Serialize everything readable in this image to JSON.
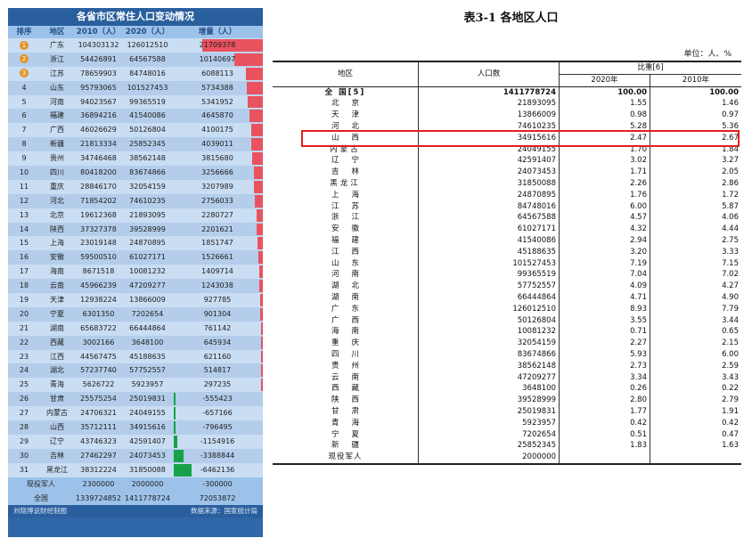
{
  "left": {
    "title": "各省市区常住人口变动情况",
    "headers": [
      "排序",
      "地区",
      "2010（人）",
      "2020（人）",
      "增量（人）"
    ],
    "max_abs": 21709378,
    "rows": [
      {
        "rank": "1",
        "region": "广东",
        "y2010": "104303132",
        "y2020": "126012510",
        "diff": "21709378",
        "v": 21709378
      },
      {
        "rank": "2",
        "region": "浙江",
        "y2010": "54426891",
        "y2020": "64567588",
        "diff": "10140697",
        "v": 10140697
      },
      {
        "rank": "3",
        "region": "江苏",
        "y2010": "78659903",
        "y2020": "84748016",
        "diff": "6088113",
        "v": 6088113
      },
      {
        "rank": "4",
        "region": "山东",
        "y2010": "95793065",
        "y2020": "101527453",
        "diff": "5734388",
        "v": 5734388
      },
      {
        "rank": "5",
        "region": "河南",
        "y2010": "94023567",
        "y2020": "99365519",
        "diff": "5341952",
        "v": 5341952
      },
      {
        "rank": "6",
        "region": "福建",
        "y2010": "36894216",
        "y2020": "41540086",
        "diff": "4645870",
        "v": 4645870
      },
      {
        "rank": "7",
        "region": "广西",
        "y2010": "46026629",
        "y2020": "50126804",
        "diff": "4100175",
        "v": 4100175
      },
      {
        "rank": "8",
        "region": "新疆",
        "y2010": "21813334",
        "y2020": "25852345",
        "diff": "4039011",
        "v": 4039011
      },
      {
        "rank": "9",
        "region": "贵州",
        "y2010": "34746468",
        "y2020": "38562148",
        "diff": "3815680",
        "v": 3815680
      },
      {
        "rank": "10",
        "region": "四川",
        "y2010": "80418200",
        "y2020": "83674866",
        "diff": "3256666",
        "v": 3256666
      },
      {
        "rank": "11",
        "region": "重庆",
        "y2010": "28846170",
        "y2020": "32054159",
        "diff": "3207989",
        "v": 3207989
      },
      {
        "rank": "12",
        "region": "河北",
        "y2010": "71854202",
        "y2020": "74610235",
        "diff": "2756033",
        "v": 2756033
      },
      {
        "rank": "13",
        "region": "北京",
        "y2010": "19612368",
        "y2020": "21893095",
        "diff": "2280727",
        "v": 2280727
      },
      {
        "rank": "14",
        "region": "陕西",
        "y2010": "37327378",
        "y2020": "39528999",
        "diff": "2201621",
        "v": 2201621
      },
      {
        "rank": "15",
        "region": "上海",
        "y2010": "23019148",
        "y2020": "24870895",
        "diff": "1851747",
        "v": 1851747
      },
      {
        "rank": "16",
        "region": "安徽",
        "y2010": "59500510",
        "y2020": "61027171",
        "diff": "1526661",
        "v": 1526661
      },
      {
        "rank": "17",
        "region": "海南",
        "y2010": "8671518",
        "y2020": "10081232",
        "diff": "1409714",
        "v": 1409714
      },
      {
        "rank": "18",
        "region": "云南",
        "y2010": "45966239",
        "y2020": "47209277",
        "diff": "1243038",
        "v": 1243038
      },
      {
        "rank": "19",
        "region": "天津",
        "y2010": "12938224",
        "y2020": "13866009",
        "diff": "927785",
        "v": 927785
      },
      {
        "rank": "20",
        "region": "宁夏",
        "y2010": "6301350",
        "y2020": "7202654",
        "diff": "901304",
        "v": 901304
      },
      {
        "rank": "21",
        "region": "湖南",
        "y2010": "65683722",
        "y2020": "66444864",
        "diff": "761142",
        "v": 761142
      },
      {
        "rank": "22",
        "region": "西藏",
        "y2010": "3002166",
        "y2020": "3648100",
        "diff": "645934",
        "v": 645934
      },
      {
        "rank": "23",
        "region": "江西",
        "y2010": "44567475",
        "y2020": "45188635",
        "diff": "621160",
        "v": 621160
      },
      {
        "rank": "24",
        "region": "湖北",
        "y2010": "57237740",
        "y2020": "57752557",
        "diff": "514817",
        "v": 514817
      },
      {
        "rank": "25",
        "region": "青海",
        "y2010": "5626722",
        "y2020": "5923957",
        "diff": "297235",
        "v": 297235
      },
      {
        "rank": "26",
        "region": "甘肃",
        "y2010": "25575254",
        "y2020": "25019831",
        "diff": "-555423",
        "v": -555423
      },
      {
        "rank": "27",
        "region": "内蒙古",
        "y2010": "24706321",
        "y2020": "24049155",
        "diff": "-657166",
        "v": -657166
      },
      {
        "rank": "28",
        "region": "山西",
        "y2010": "35712111",
        "y2020": "34915616",
        "diff": "-796495",
        "v": -796495
      },
      {
        "rank": "29",
        "region": "辽宁",
        "y2010": "43746323",
        "y2020": "42591407",
        "diff": "-1154916",
        "v": -1154916
      },
      {
        "rank": "30",
        "region": "吉林",
        "y2010": "27462297",
        "y2020": "24073453",
        "diff": "-3388844",
        "v": -3388844
      },
      {
        "rank": "31",
        "region": "黑龙江",
        "y2010": "38312224",
        "y2020": "31850088",
        "diff": "-6462136",
        "v": -6462136
      }
    ],
    "military": {
      "label": "现役军人",
      "y2010": "2300000",
      "y2020": "2000000",
      "diff": "-300000"
    },
    "national": {
      "label": "全国",
      "y2010": "1339724852",
      "y2020": "1411778724",
      "diff": "72053872"
    },
    "footer_left": "刘晓博说财经制图",
    "footer_right": "数据来源：国家统计局"
  },
  "right": {
    "title": "表3-1 各地区人口",
    "unit": "单位：人、%",
    "col_region": "地区",
    "col_pop": "人口数",
    "col_share": "比重[6]",
    "col_2020": "2020年",
    "col_2010": "2010年",
    "total": {
      "name": "全 国[5]",
      "pop": "1411778724",
      "s2020": "100.00",
      "s2010": "100.00"
    },
    "rows": [
      {
        "name": "北京",
        "pop": "21893095",
        "s2020": "1.55",
        "s2010": "1.46"
      },
      {
        "name": "天津",
        "pop": "13866009",
        "s2020": "0.98",
        "s2010": "0.97"
      },
      {
        "name": "河北",
        "pop": "74610235",
        "s2020": "5.28",
        "s2010": "5.36"
      },
      {
        "name": "山西",
        "pop": "34915616",
        "s2020": "2.47",
        "s2010": "2.67"
      },
      {
        "name": "内蒙古",
        "pop": "24049155",
        "s2020": "1.70",
        "s2010": "1.84"
      },
      {
        "name": "辽宁",
        "pop": "42591407",
        "s2020": "3.02",
        "s2010": "3.27"
      },
      {
        "name": "吉林",
        "pop": "24073453",
        "s2020": "1.71",
        "s2010": "2.05"
      },
      {
        "name": "黑龙江",
        "pop": "31850088",
        "s2020": "2.26",
        "s2010": "2.86"
      },
      {
        "name": "上海",
        "pop": "24870895",
        "s2020": "1.76",
        "s2010": "1.72"
      },
      {
        "name": "江苏",
        "pop": "84748016",
        "s2020": "6.00",
        "s2010": "5.87"
      },
      {
        "name": "浙江",
        "pop": "64567588",
        "s2020": "4.57",
        "s2010": "4.06"
      },
      {
        "name": "安徽",
        "pop": "61027171",
        "s2020": "4.32",
        "s2010": "4.44"
      },
      {
        "name": "福建",
        "pop": "41540086",
        "s2020": "2.94",
        "s2010": "2.75"
      },
      {
        "name": "江西",
        "pop": "45188635",
        "s2020": "3.20",
        "s2010": "3.33"
      },
      {
        "name": "山东",
        "pop": "101527453",
        "s2020": "7.19",
        "s2010": "7.15"
      },
      {
        "name": "河南",
        "pop": "99365519",
        "s2020": "7.04",
        "s2010": "7.02"
      },
      {
        "name": "湖北",
        "pop": "57752557",
        "s2020": "4.09",
        "s2010": "4.27"
      },
      {
        "name": "湖南",
        "pop": "66444864",
        "s2020": "4.71",
        "s2010": "4.90"
      },
      {
        "name": "广东",
        "pop": "126012510",
        "s2020": "8.93",
        "s2010": "7.79"
      },
      {
        "name": "广西",
        "pop": "50126804",
        "s2020": "3.55",
        "s2010": "3.44"
      },
      {
        "name": "海南",
        "pop": "10081232",
        "s2020": "0.71",
        "s2010": "0.65"
      },
      {
        "name": "重庆",
        "pop": "32054159",
        "s2020": "2.27",
        "s2010": "2.15"
      },
      {
        "name": "四川",
        "pop": "83674866",
        "s2020": "5.93",
        "s2010": "6.00"
      },
      {
        "name": "贵州",
        "pop": "38562148",
        "s2020": "2.73",
        "s2010": "2.59"
      },
      {
        "name": "云南",
        "pop": "47209277",
        "s2020": "3.34",
        "s2010": "3.43"
      },
      {
        "name": "西藏",
        "pop": "3648100",
        "s2020": "0.26",
        "s2010": "0.22"
      },
      {
        "name": "陕西",
        "pop": "39528999",
        "s2020": "2.80",
        "s2010": "2.79"
      },
      {
        "name": "甘肃",
        "pop": "25019831",
        "s2020": "1.77",
        "s2010": "1.91"
      },
      {
        "name": "青海",
        "pop": "5923957",
        "s2020": "0.42",
        "s2010": "0.42"
      },
      {
        "name": "宁夏",
        "pop": "7202654",
        "s2020": "0.51",
        "s2010": "0.47"
      },
      {
        "name": "新疆",
        "pop": "25852345",
        "s2020": "1.83",
        "s2010": "1.63"
      },
      {
        "name": "现役军人",
        "pop": "2000000",
        "s2020": "",
        "s2010": ""
      }
    ],
    "highlight_color": "#e0211e"
  }
}
